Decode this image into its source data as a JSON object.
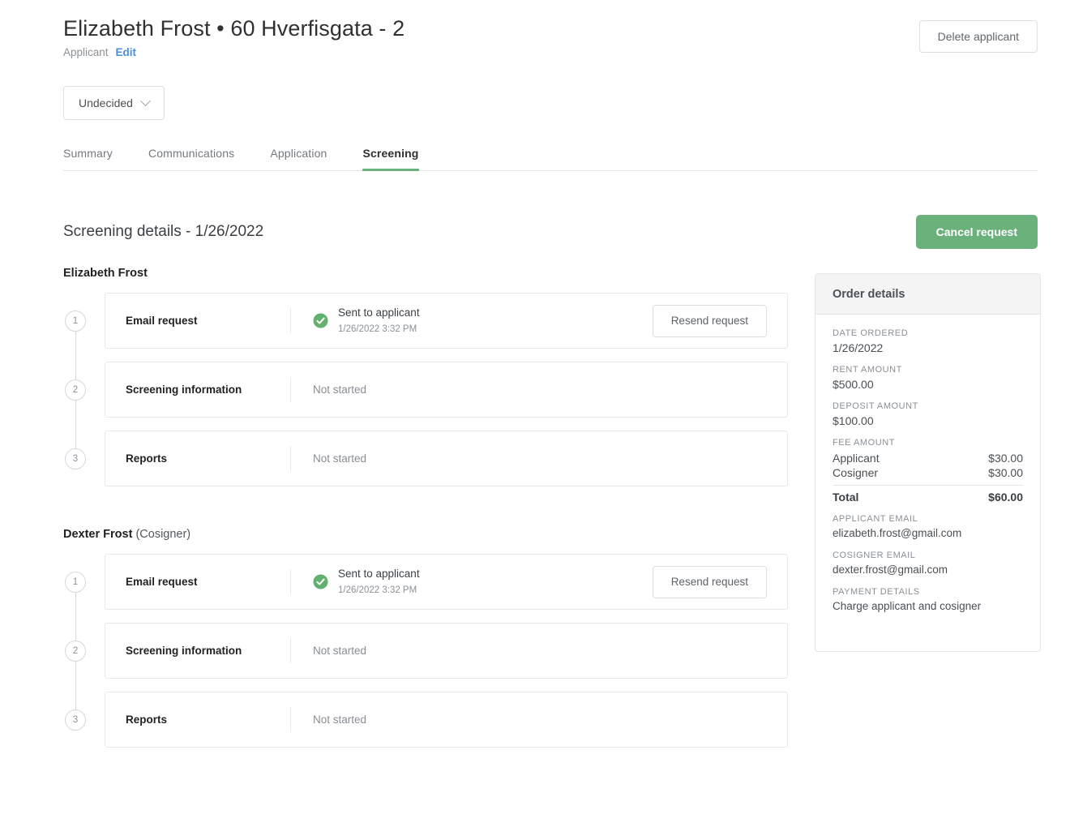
{
  "header": {
    "title": "Elizabeth Frost • 60 Hverfisgata - 2",
    "subtitle": "Applicant",
    "edit_link": "Edit",
    "delete_button": "Delete applicant"
  },
  "status": {
    "current": "Undecided",
    "caret_icon": "chevron-down-icon"
  },
  "tabs": [
    {
      "label": "Summary",
      "active": false
    },
    {
      "label": "Communications",
      "active": false
    },
    {
      "label": "Application",
      "active": false
    },
    {
      "label": "Screening",
      "active": true
    }
  ],
  "section": {
    "title": "Screening details - 1/26/2022",
    "cancel_button": "Cancel request"
  },
  "people": [
    {
      "name": "Elizabeth Frost",
      "role": "",
      "steps": [
        {
          "number": "1",
          "label": "Email request",
          "status": "Sent to applicant",
          "timestamp": "1/26/2022 3:32 PM",
          "has_check": true,
          "action": "Resend request"
        },
        {
          "number": "2",
          "label": "Screening information",
          "status": "Not started",
          "timestamp": "",
          "has_check": false,
          "action": ""
        },
        {
          "number": "3",
          "label": "Reports",
          "status": "Not started",
          "timestamp": "",
          "has_check": false,
          "action": ""
        }
      ]
    },
    {
      "name": "Dexter Frost",
      "role": "(Cosigner)",
      "steps": [
        {
          "number": "1",
          "label": "Email request",
          "status": "Sent to applicant",
          "timestamp": "1/26/2022 3:32 PM",
          "has_check": true,
          "action": "Resend request"
        },
        {
          "number": "2",
          "label": "Screening information",
          "status": "Not started",
          "timestamp": "",
          "has_check": false,
          "action": ""
        },
        {
          "number": "3",
          "label": "Reports",
          "status": "Not started",
          "timestamp": "",
          "has_check": false,
          "action": ""
        }
      ]
    }
  ],
  "order_details": {
    "heading": "Order details",
    "date_ordered_label": "DATE ORDERED",
    "date_ordered_value": "1/26/2022",
    "rent_amount_label": "RENT AMOUNT",
    "rent_amount_value": "$500.00",
    "deposit_amount_label": "DEPOSIT AMOUNT",
    "deposit_amount_value": "$100.00",
    "fee_amount_label": "FEE AMOUNT",
    "fees": [
      {
        "name": "Applicant",
        "amount": "$30.00"
      },
      {
        "name": "Cosigner",
        "amount": "$30.00"
      }
    ],
    "total_label": "Total",
    "total_value": "$60.00",
    "applicant_email_label": "APPLICANT EMAIL",
    "applicant_email_value": "elizabeth.frost@gmail.com",
    "cosigner_email_label": "COSIGNER EMAIL",
    "cosigner_email_value": "dexter.frost@gmail.com",
    "payment_details_label": "PAYMENT DETAILS",
    "payment_details_value": "Charge applicant and cosigner"
  },
  "colors": {
    "accent_green": "#6bb17c",
    "link_blue": "#4a90d9",
    "panel_header_bg": "#f4f4f4",
    "border": "#e4e6e8"
  }
}
